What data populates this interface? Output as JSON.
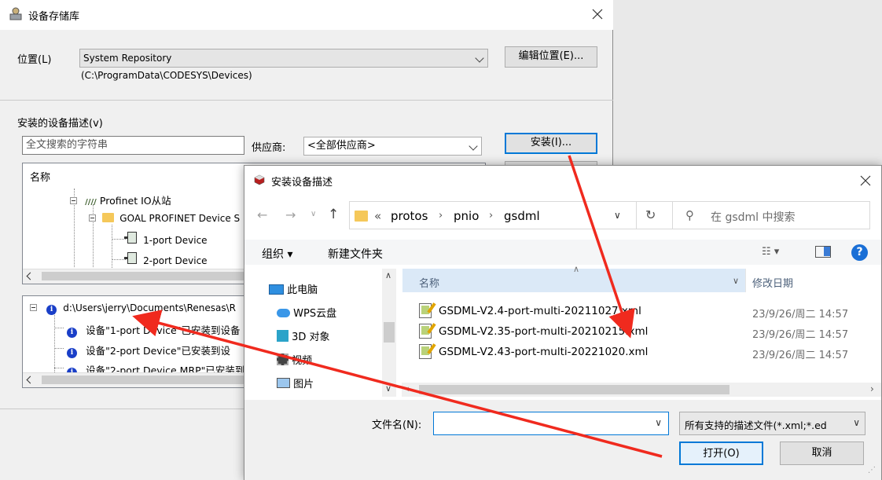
{
  "main_dialog": {
    "title": "设备存储库",
    "location_label": "位置(L)",
    "location_value": "System Repository",
    "location_path": "(C:\\ProgramData\\CODESYS\\Devices)",
    "edit_location_button": "编辑位置(E)...",
    "installed_label": "安装的设备描述(v)",
    "search_placeholder": "全文搜索的字符串",
    "vendor_label": "供应商:",
    "vendor_value": "<全部供应商>",
    "install_button": "安装(I)...",
    "tree_header": "名称",
    "tree_items": [
      "Profinet IO从站",
      "GOAL PROFINET Device S",
      "1-port Device",
      "2-port Device"
    ],
    "log_items": [
      "d:\\Users\\jerry\\Documents\\Renesas\\R",
      "设备\"1-port Device\"已安装到设备",
      "设备\"2-port Device\"已安装到设",
      "设备\"2-port Device MRP\"已安装到"
    ]
  },
  "file_dialog": {
    "title": "安装设备描述",
    "breadcrumb": [
      "«",
      "protos",
      "pnio",
      "gsdml"
    ],
    "search_placeholder": "在 gsdml 中搜索",
    "organize_button": "组织 ▾",
    "new_folder_button": "新建文件夹",
    "nav_items": [
      "此电脑",
      "WPS云盘",
      "3D 对象",
      "视频",
      "图片"
    ],
    "col_name": "名称",
    "col_modified": "修改日期",
    "files": [
      {
        "name": "GSDML-V2.4-port-multi-20211027.xml",
        "date": "23/9/26/周二 14:57"
      },
      {
        "name": "GSDML-V2.35-port-multi-20210215.xml",
        "date": "23/9/26/周二 14:57"
      },
      {
        "name": "GSDML-V2.43-port-multi-20221020.xml",
        "date": "23/9/26/周二 14:57"
      }
    ],
    "filename_label": "文件名(N):",
    "filename_value": "",
    "filter_value": "所有支持的描述文件(*.xml;*.ed",
    "open_button": "打开(O)",
    "cancel_button": "取消"
  },
  "colors": {
    "annotation_arrow": "#f02a1e",
    "selection_blue": "#0078d7",
    "help_blue": "#1a6fd6"
  }
}
